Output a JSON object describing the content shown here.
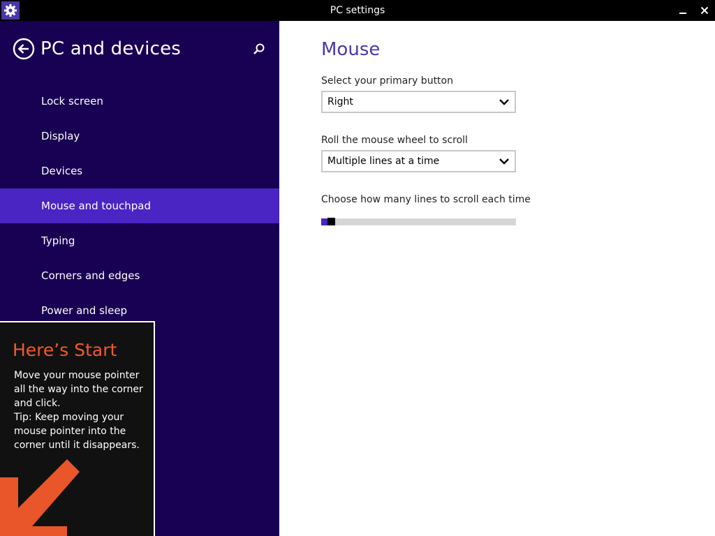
{
  "window": {
    "title": "PC settings",
    "icon": "gear-icon",
    "accent": "#4b37a8"
  },
  "nav": {
    "title": "PC and devices",
    "background": "#180052",
    "selected_color": "#4b24c4",
    "items": [
      {
        "label": "Lock screen",
        "selected": false
      },
      {
        "label": "Display",
        "selected": false
      },
      {
        "label": "Devices",
        "selected": false
      },
      {
        "label": "Mouse and touchpad",
        "selected": true
      },
      {
        "label": "Typing",
        "selected": false
      },
      {
        "label": "Corners and edges",
        "selected": false
      },
      {
        "label": "Power and sleep",
        "selected": false
      }
    ]
  },
  "start_tip": {
    "title": "Here’s Start",
    "body": "Move your mouse pointer\nall the way into the corner\nand click.\nTip: Keep moving your\nmouse pointer into the\ncorner until it disappears.",
    "title_color": "#f25a2a",
    "arrow_color": "#e8562a"
  },
  "main": {
    "title": "Mouse",
    "primary_button": {
      "label": "Select your primary button",
      "value": "Right"
    },
    "wheel_scroll": {
      "label": "Roll the mouse wheel to scroll",
      "value": "Multiple lines at a time"
    },
    "lines_to_scroll": {
      "label": "Choose how many lines to scroll each time",
      "level": 0.02
    }
  }
}
